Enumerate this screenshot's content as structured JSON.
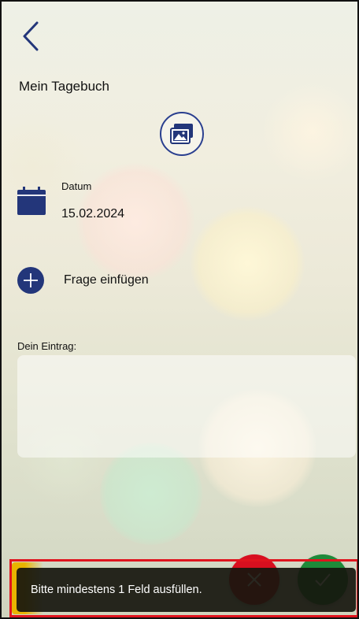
{
  "header": {
    "back_icon": "chevron-left-icon",
    "title": "Mein Tagebuch"
  },
  "media": {
    "image_icon": "image-gallery-icon"
  },
  "date": {
    "icon": "calendar-icon",
    "label": "Datum",
    "value": "15.02.2024"
  },
  "question": {
    "icon": "plus-icon",
    "label": "Frage einfügen"
  },
  "entry": {
    "label": "Dein Eintrag:",
    "value": "",
    "placeholder": ""
  },
  "actions": {
    "cancel_icon": "close-icon",
    "confirm_icon": "check-icon"
  },
  "toast": {
    "message": "Bitte mindestens 1 Feld ausfüllen."
  },
  "colors": {
    "accent": "#23367a",
    "cancel": "#d80f1f",
    "confirm": "#1f8a3a",
    "highlight": "#e0141e",
    "toast_bg": "#16160e"
  }
}
